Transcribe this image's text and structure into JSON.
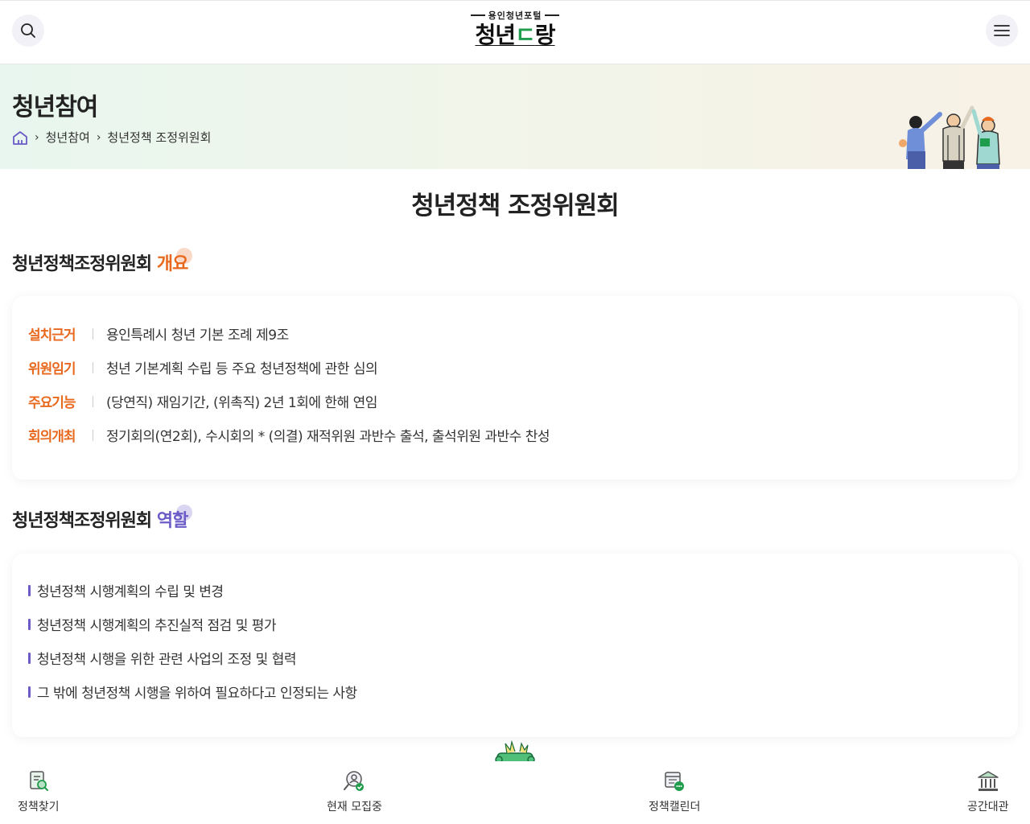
{
  "header": {
    "logo_sub": "용인청년포털",
    "logo_main_pre": "청년",
    "logo_main_mid": "ㄷ",
    "logo_main_post": "랑"
  },
  "banner": {
    "title": "청년참여",
    "breadcrumb": [
      "청년참여",
      "청년정책 조정위원회"
    ]
  },
  "page_title": "청년정책 조정위원회",
  "overview": {
    "title_main": "청년정책조정위원회 ",
    "title_highlight": "개요",
    "rows": [
      {
        "label": "설치근거",
        "value": "용인특례시 청년 기본 조례 제9조"
      },
      {
        "label": "위원임기",
        "value": "청년 기본계획 수립 등 주요 청년정책에 관한 심의"
      },
      {
        "label": "주요기능",
        "value": "(당연직) 재임기간, (위촉직) 2년 1회에 한해 연임"
      },
      {
        "label": "회의개최",
        "value": "정기회의(연2회), 수시회의 * (의결) 재적위원 과반수 출석, 출석위원 과반수 찬성"
      }
    ]
  },
  "roles": {
    "title_main": "청년정책조정위원회 ",
    "title_highlight": "역할",
    "items": [
      "청년정책 시행계획의 수립 및 변경",
      "청년정책 시행계획의 추진실적 점검 및 평가",
      "청년정책 시행을 위한 관련 사업의 조정 및 협력",
      "그 밖에 청년정책 시행을 위하여 필요하다고 인정되는 사항"
    ]
  },
  "bottom_nav": [
    {
      "label": "정책찾기",
      "icon": "policy-search-icon"
    },
    {
      "label": "현재 모집중",
      "icon": "recruiting-icon"
    },
    {
      "label": "정책캘린더",
      "icon": "calendar-chat-icon"
    },
    {
      "label": "공간대관",
      "icon": "building-icon"
    }
  ],
  "colors": {
    "accent_orange": "#e8691e",
    "accent_purple": "#6a5bc7",
    "accent_green": "#1f9d4c"
  }
}
